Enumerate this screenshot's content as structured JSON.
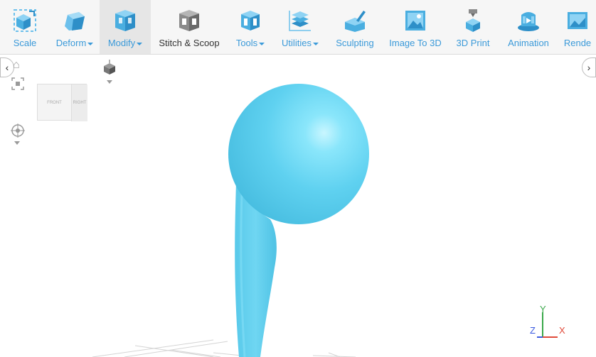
{
  "toolbar": {
    "items": [
      {
        "label": "Scale",
        "icon": "scale-icon"
      },
      {
        "label": "Deform",
        "icon": "deform-icon",
        "dropdown": true
      },
      {
        "label": "Modify",
        "icon": "modify-icon",
        "dropdown": true,
        "active": true
      },
      {
        "label": "Stitch & Scoop",
        "icon": "stitch-scoop-icon"
      },
      {
        "label": "Tools",
        "icon": "tools-icon",
        "dropdown": true
      },
      {
        "label": "Utilities",
        "icon": "utilities-icon",
        "dropdown": true
      },
      {
        "label": "Sculpting",
        "icon": "sculpting-icon"
      },
      {
        "label": "Image To 3D",
        "icon": "image-to-3d-icon"
      },
      {
        "label": "3D Print",
        "icon": "3d-print-icon"
      },
      {
        "label": "Animation",
        "icon": "animation-icon"
      },
      {
        "label": "Rende",
        "icon": "render-icon"
      }
    ]
  },
  "viewport": {
    "view_cube": {
      "front_label": "FRONT",
      "right_label": "RIGHT"
    },
    "axes": {
      "y": "Y",
      "z": "Z",
      "x": "X"
    }
  },
  "colors": {
    "accent": "#3b9ad9",
    "model": "#5fd1f0",
    "axis_x": "#e04a3a",
    "axis_y": "#3aa84a",
    "axis_z": "#3a5ae0"
  }
}
